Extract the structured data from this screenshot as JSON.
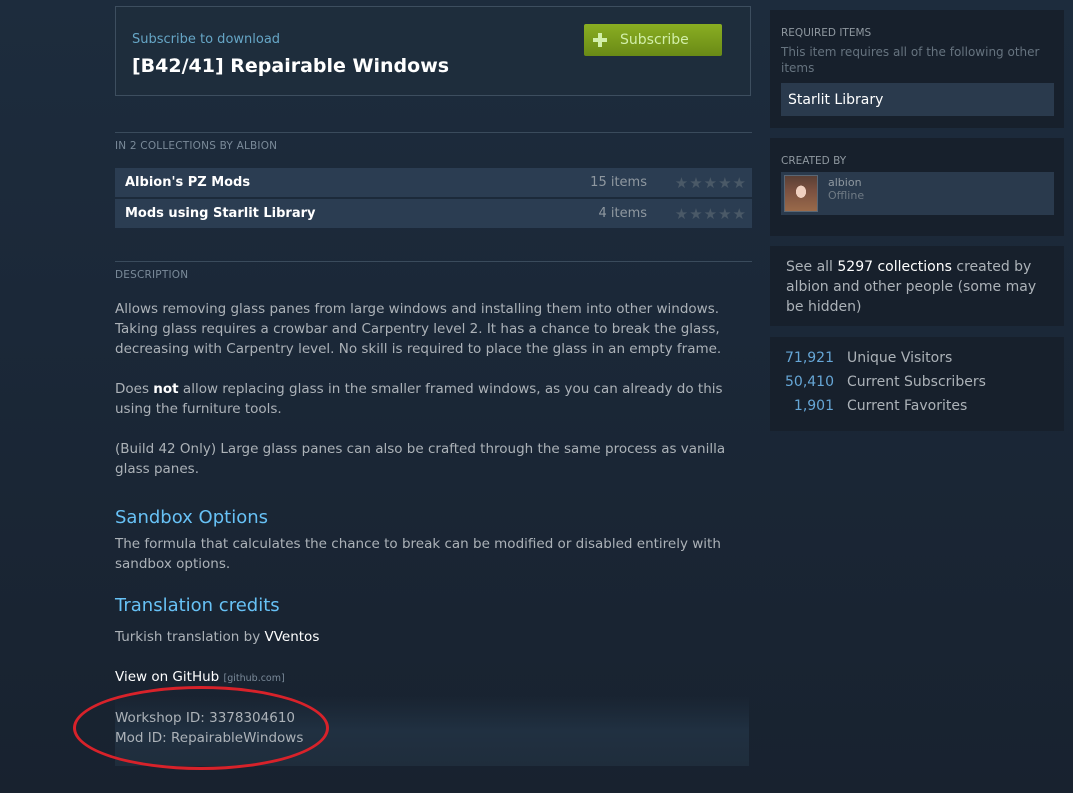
{
  "subscribe": {
    "subtitle": "Subscribe to download",
    "title": "[B42/41] Repairable Windows",
    "button_label": "Subscribe"
  },
  "collections": {
    "header": "IN 2 COLLECTIONS BY ALBION",
    "items": [
      {
        "name": "Albion's PZ Mods",
        "count": "15 items",
        "stars": "★★★★★"
      },
      {
        "name": "Mods using Starlit Library",
        "count": "4 items",
        "stars": "★★★★★"
      }
    ]
  },
  "description": {
    "header": "DESCRIPTION",
    "p1": "Allows removing glass panes from large windows and installing them into other windows. Taking glass requires a crowbar and Carpentry level 2. It has a chance to break the glass, decreasing with Carpentry level. No skill is required to place the glass in an empty frame.",
    "p2_before": "Does ",
    "p2_bold": "not",
    "p2_after": " allow replacing glass in the smaller framed windows, as you can already do this using the furniture tools.",
    "p3": "(Build 42 Only) Large glass panes can also be crafted through the same process as vanilla glass panes.",
    "sandbox_heading": "Sandbox Options",
    "sandbox_text": "The formula that calculates the chance to break can be modified or disabled entirely with sandbox options.",
    "translation_heading": "Translation credits",
    "translation_before": "Turkish translation by ",
    "translation_name": "VVentos",
    "github_label": "View on GitHub",
    "github_domain": "[github.com]",
    "workshop_id": "Workshop ID: 3378304610",
    "mod_id": "Mod ID: RepairableWindows"
  },
  "sidebar": {
    "required": {
      "header": "REQUIRED ITEMS",
      "subtitle": "This item requires all of the following other items",
      "item": "Starlit Library"
    },
    "creator": {
      "header": "CREATED BY",
      "name": "albion",
      "status": "Offline"
    },
    "see_all": {
      "before": "See all ",
      "count": "5297 collections",
      "after": " created by albion and other people (some may be hidden)"
    },
    "stats": [
      {
        "value": "71,921",
        "label": "Unique Visitors"
      },
      {
        "value": "50,410",
        "label": "Current Subscribers"
      },
      {
        "value": "1,901",
        "label": "Current Favorites"
      }
    ]
  },
  "colors": {
    "background": "#1b2838",
    "accent_link": "#67c1f5",
    "subscribe_green": "#7ea31c",
    "highlight_red": "#d8222a"
  }
}
